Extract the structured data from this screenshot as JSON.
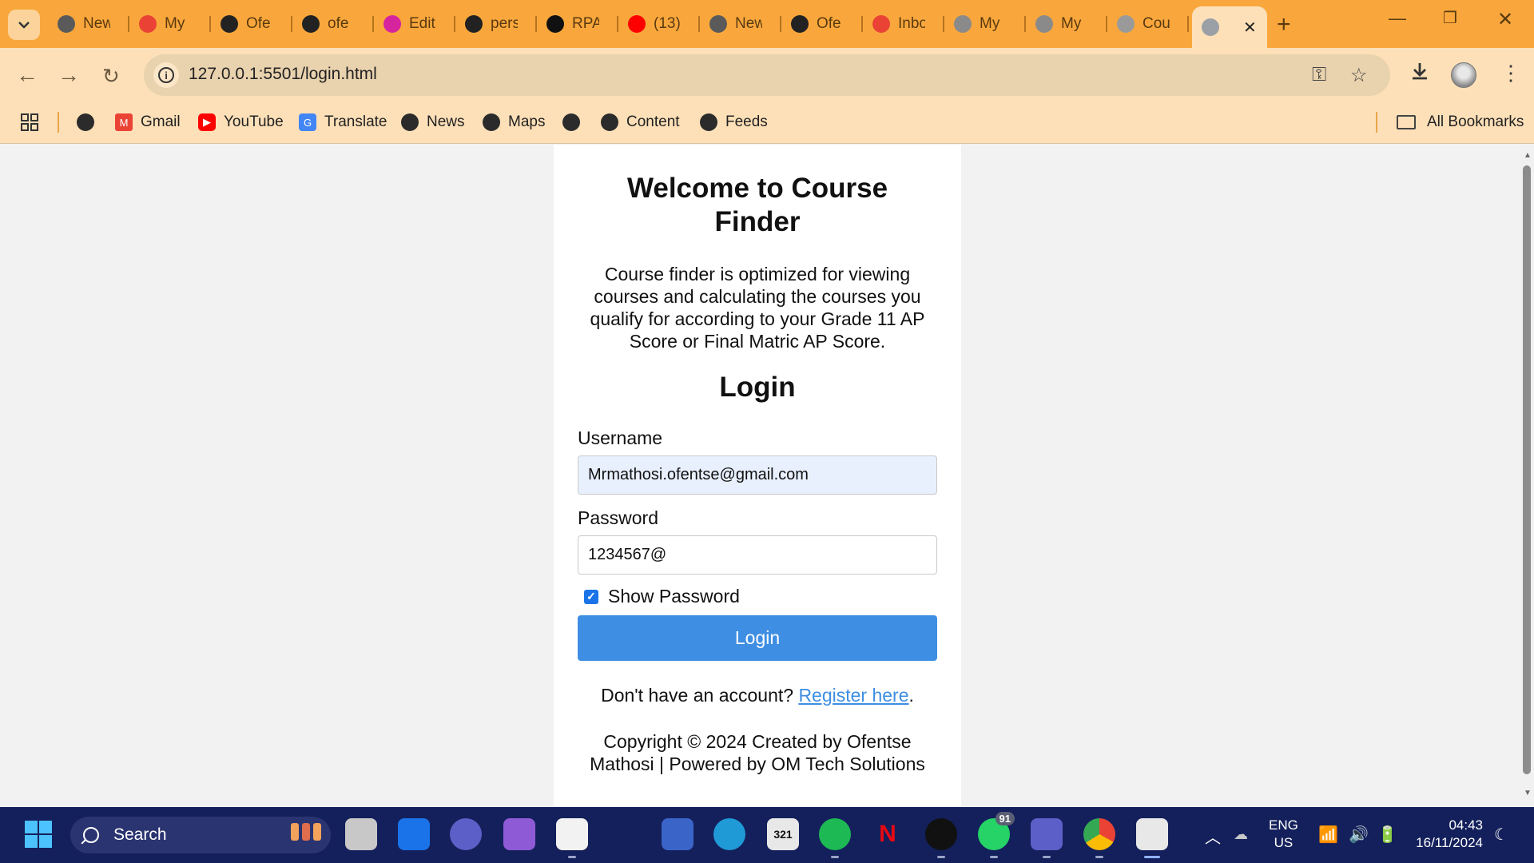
{
  "browser": {
    "tabs": [
      {
        "title": "New",
        "icon": "chrome-icon",
        "color": "#5a5a5a"
      },
      {
        "title": "My",
        "icon": "gmail-icon",
        "color": "#ea4335"
      },
      {
        "title": "Ofe",
        "icon": "github-icon",
        "color": "#222222"
      },
      {
        "title": "ofe",
        "icon": "github-icon",
        "color": "#222222"
      },
      {
        "title": "Edit",
        "icon": "instagram-icon",
        "color": "#d6249f"
      },
      {
        "title": "pers",
        "icon": "github-icon",
        "color": "#222222"
      },
      {
        "title": "RPA",
        "icon": "openai-icon",
        "color": "#111111"
      },
      {
        "title": "(13)",
        "icon": "youtube-icon",
        "color": "#ff0000"
      },
      {
        "title": "New",
        "icon": "chrome-icon",
        "color": "#5a5a5a"
      },
      {
        "title": "Ofe",
        "icon": "github-icon",
        "color": "#222222"
      },
      {
        "title": "Inbo",
        "icon": "gmail-icon",
        "color": "#ea4335"
      },
      {
        "title": "My",
        "icon": "globe-icon",
        "color": "#8a8a8a"
      },
      {
        "title": "My",
        "icon": "globe-icon",
        "color": "#8a8a8a"
      },
      {
        "title": "Cou",
        "icon": "smile-icon",
        "color": "#9a9a9a"
      }
    ],
    "url": "127.0.0.1:5501/login.html",
    "bookmarks": [
      {
        "label": "",
        "icon": "globe-icon"
      },
      {
        "label": "Gmail",
        "icon": "gmail-icon"
      },
      {
        "label": "YouTube",
        "icon": "youtube-icon"
      },
      {
        "label": "Translate",
        "icon": "translate-icon"
      },
      {
        "label": "News",
        "icon": "globe-icon"
      },
      {
        "label": "Maps",
        "icon": "globe-icon"
      },
      {
        "label": "",
        "icon": "globe-icon"
      },
      {
        "label": "Content",
        "icon": "globe-icon"
      },
      {
        "label": "Feeds",
        "icon": "globe-icon"
      }
    ],
    "all_bookmarks_label": "All Bookmarks",
    "accent_color": "#f9a73c"
  },
  "page": {
    "title": "Welcome to Course Finder",
    "intro": "Course finder is optimized for viewing courses and calculating the courses you qualify for according to your Grade 11 AP Score or Final Matric AP Score.",
    "login_heading": "Login",
    "username_label": "Username",
    "username_value": "Mrmathosi.ofentse@gmail.com",
    "password_label": "Password",
    "password_value": "1234567@",
    "show_password_label": "Show Password",
    "show_password_checked": true,
    "login_button": "Login",
    "register_prefix": "Don't have an account?",
    "register_link": "Register here",
    "register_suffix": ".",
    "copyright": "Copyright © 2024 Created by Ofentse Mathosi | Powered by OM Tech Solutions",
    "button_color": "#3e8ee3"
  },
  "taskbar": {
    "search_label": "Search",
    "whatsapp_badge": "91",
    "language": "ENG",
    "region": "US",
    "time": "04:43",
    "date": "16/11/2024"
  }
}
